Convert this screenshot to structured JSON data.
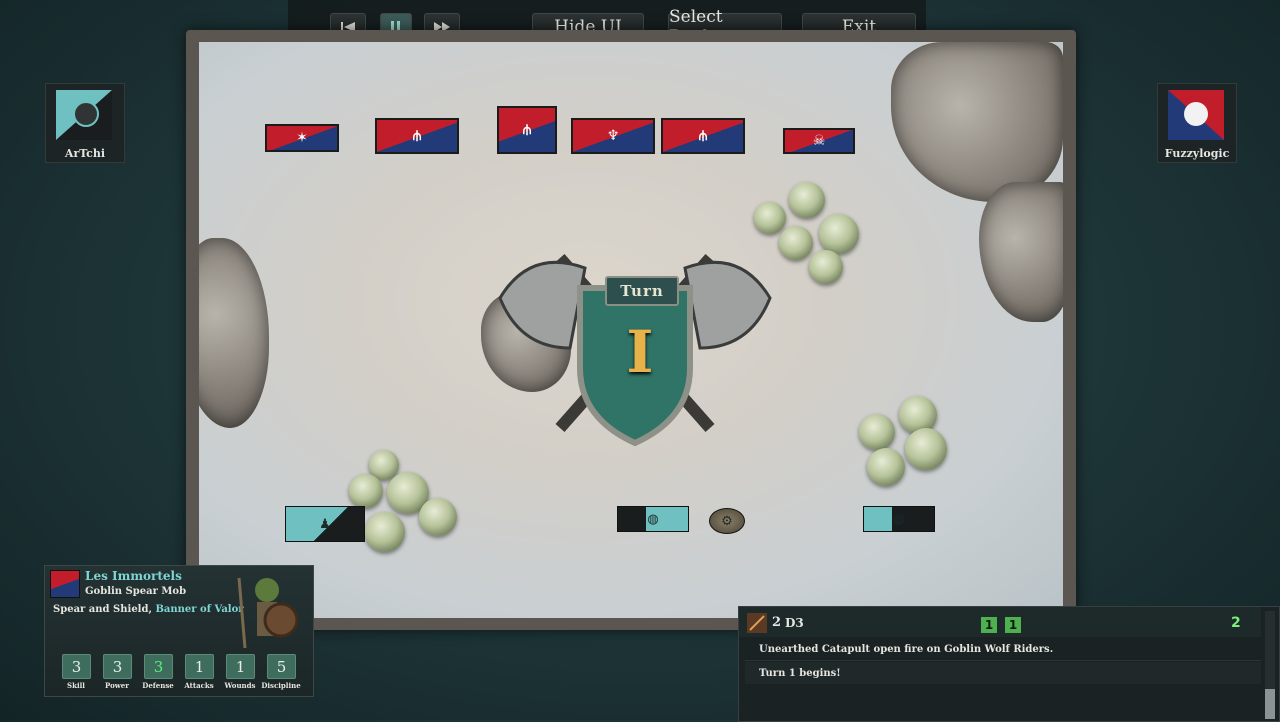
{
  "controls": {
    "hide_ui_label": "Hide UI",
    "select_replay_label": "Select Replay",
    "exit_label": "Exit"
  },
  "players": {
    "left": {
      "name": "ArTchi",
      "color": "#6fc0c0"
    },
    "right": {
      "name": "Fuzzylogic",
      "colors": [
        "#c21d2b",
        "#233a78"
      ]
    }
  },
  "turn": {
    "label": "Turn",
    "number": "I"
  },
  "selected_unit": {
    "army_name": "Les Immortels",
    "unit_type": "Goblin Spear Mob",
    "equipment": "Spear and Shield,",
    "upgrade": "Banner of Valor",
    "stats": [
      {
        "label": "Skill",
        "value": "3"
      },
      {
        "label": "Power",
        "value": "3"
      },
      {
        "label": "Defense",
        "value": "3"
      },
      {
        "label": "Attacks",
        "value": "1"
      },
      {
        "label": "Wounds",
        "value": "1"
      },
      {
        "label": "Discipline",
        "value": "5"
      }
    ]
  },
  "log": {
    "header": {
      "count": "2",
      "dice": "D3",
      "hit_a": "1",
      "hit_b": "1",
      "total": "2"
    },
    "lines": [
      "Unearthed Catapult open fire on Goblin Wolf Riders.",
      "Turn 1 begins!"
    ]
  }
}
